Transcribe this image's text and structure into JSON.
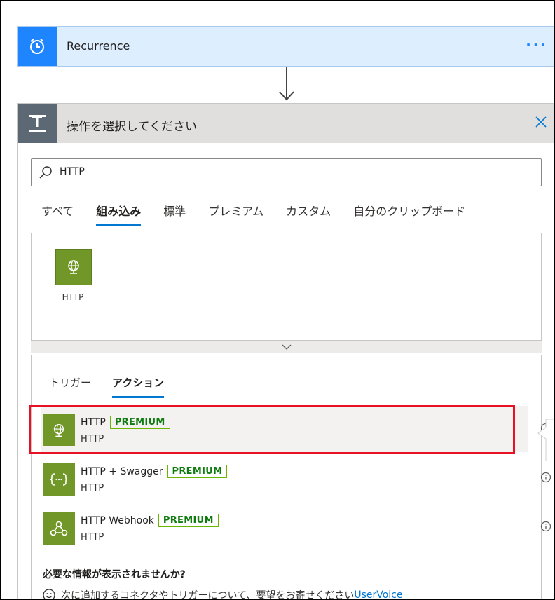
{
  "trigger": {
    "title": "Recurrence",
    "more": "···"
  },
  "choose_action": {
    "title": "操作を選択してください",
    "search": {
      "value": "HTTP",
      "placeholder": ""
    },
    "tabs": [
      {
        "label": "すべて"
      },
      {
        "label": "組み込み"
      },
      {
        "label": "標準"
      },
      {
        "label": "プレミアム"
      },
      {
        "label": "カスタム"
      },
      {
        "label": "自分のクリップボード"
      }
    ],
    "active_tab": "組み込み",
    "connector": {
      "label": "HTTP"
    },
    "subtabs": [
      {
        "label": "トリガー"
      },
      {
        "label": "アクション"
      }
    ],
    "active_subtab": "アクション",
    "actions": [
      {
        "name": "HTTP",
        "badge": "PREMIUM",
        "connector": "HTTP",
        "icon": "globe-icon"
      },
      {
        "name": "HTTP + Swagger",
        "badge": "PREMIUM",
        "connector": "HTTP",
        "icon": "swagger-braces-icon"
      },
      {
        "name": "HTTP Webhook",
        "badge": "PREMIUM",
        "connector": "HTTP",
        "icon": "webhook-icon"
      }
    ],
    "missing_title": "必要な情報が表示されませんか?",
    "suggest_text": "次に追加するコネクタやトリガーについて、要望をお寄せください",
    "suggest_link": "UserVoice"
  },
  "colors": {
    "accent": "#0078d4",
    "trigger_blue": "#1f85ff",
    "http_green": "#709727",
    "premium_green": "#107c10",
    "highlight_red": "#e81123"
  }
}
